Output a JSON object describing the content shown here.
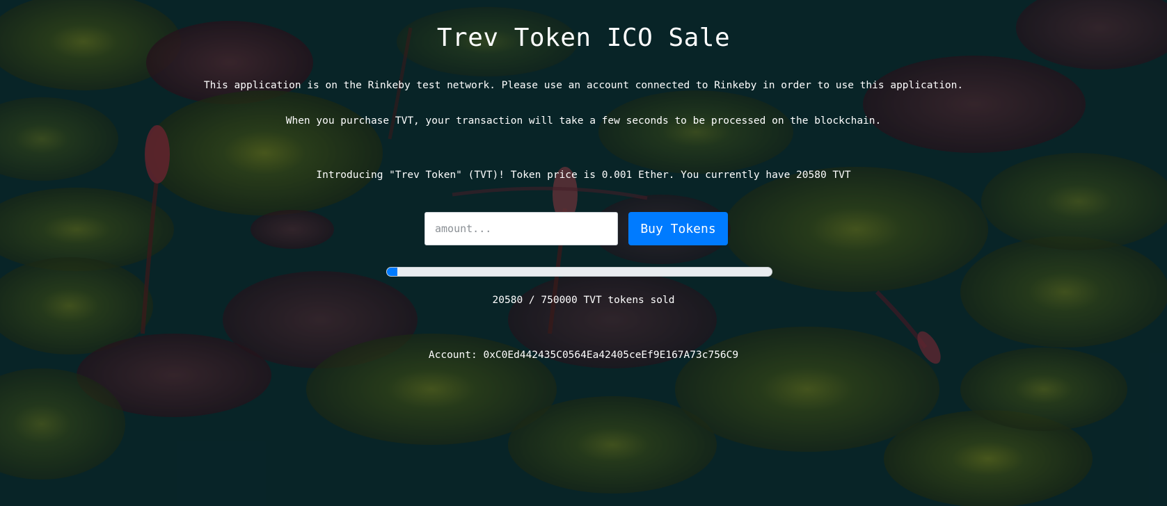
{
  "page": {
    "title": "Trev Token ICO Sale",
    "notice_network": "This application is on the Rinkeby test network. Please use an account connected to Rinkeby in order to use this application.",
    "notice_processing": "When you purchase TVT, your transaction will take a few seconds to be processed on the blockchain.",
    "intro": "Introducing \"Trev Token\" (TVT)! Token price is 0.001 Ether. You currently have 20580 TVT"
  },
  "buy_form": {
    "amount_placeholder": "amount...",
    "amount_value": "",
    "buy_label": "Buy Tokens"
  },
  "sale": {
    "tokens_sold": 20580,
    "tokens_available": 750000,
    "progress_fraction": 0.0274,
    "sold_text": "20580 / 750000 TVT tokens sold"
  },
  "account": {
    "text": "Account: 0xC0Ed442435C0564Ea42405ceEf9E167A73c756C9"
  },
  "colors": {
    "accent": "#007bff",
    "text": "#ffffff",
    "background": "#0c2d33"
  }
}
